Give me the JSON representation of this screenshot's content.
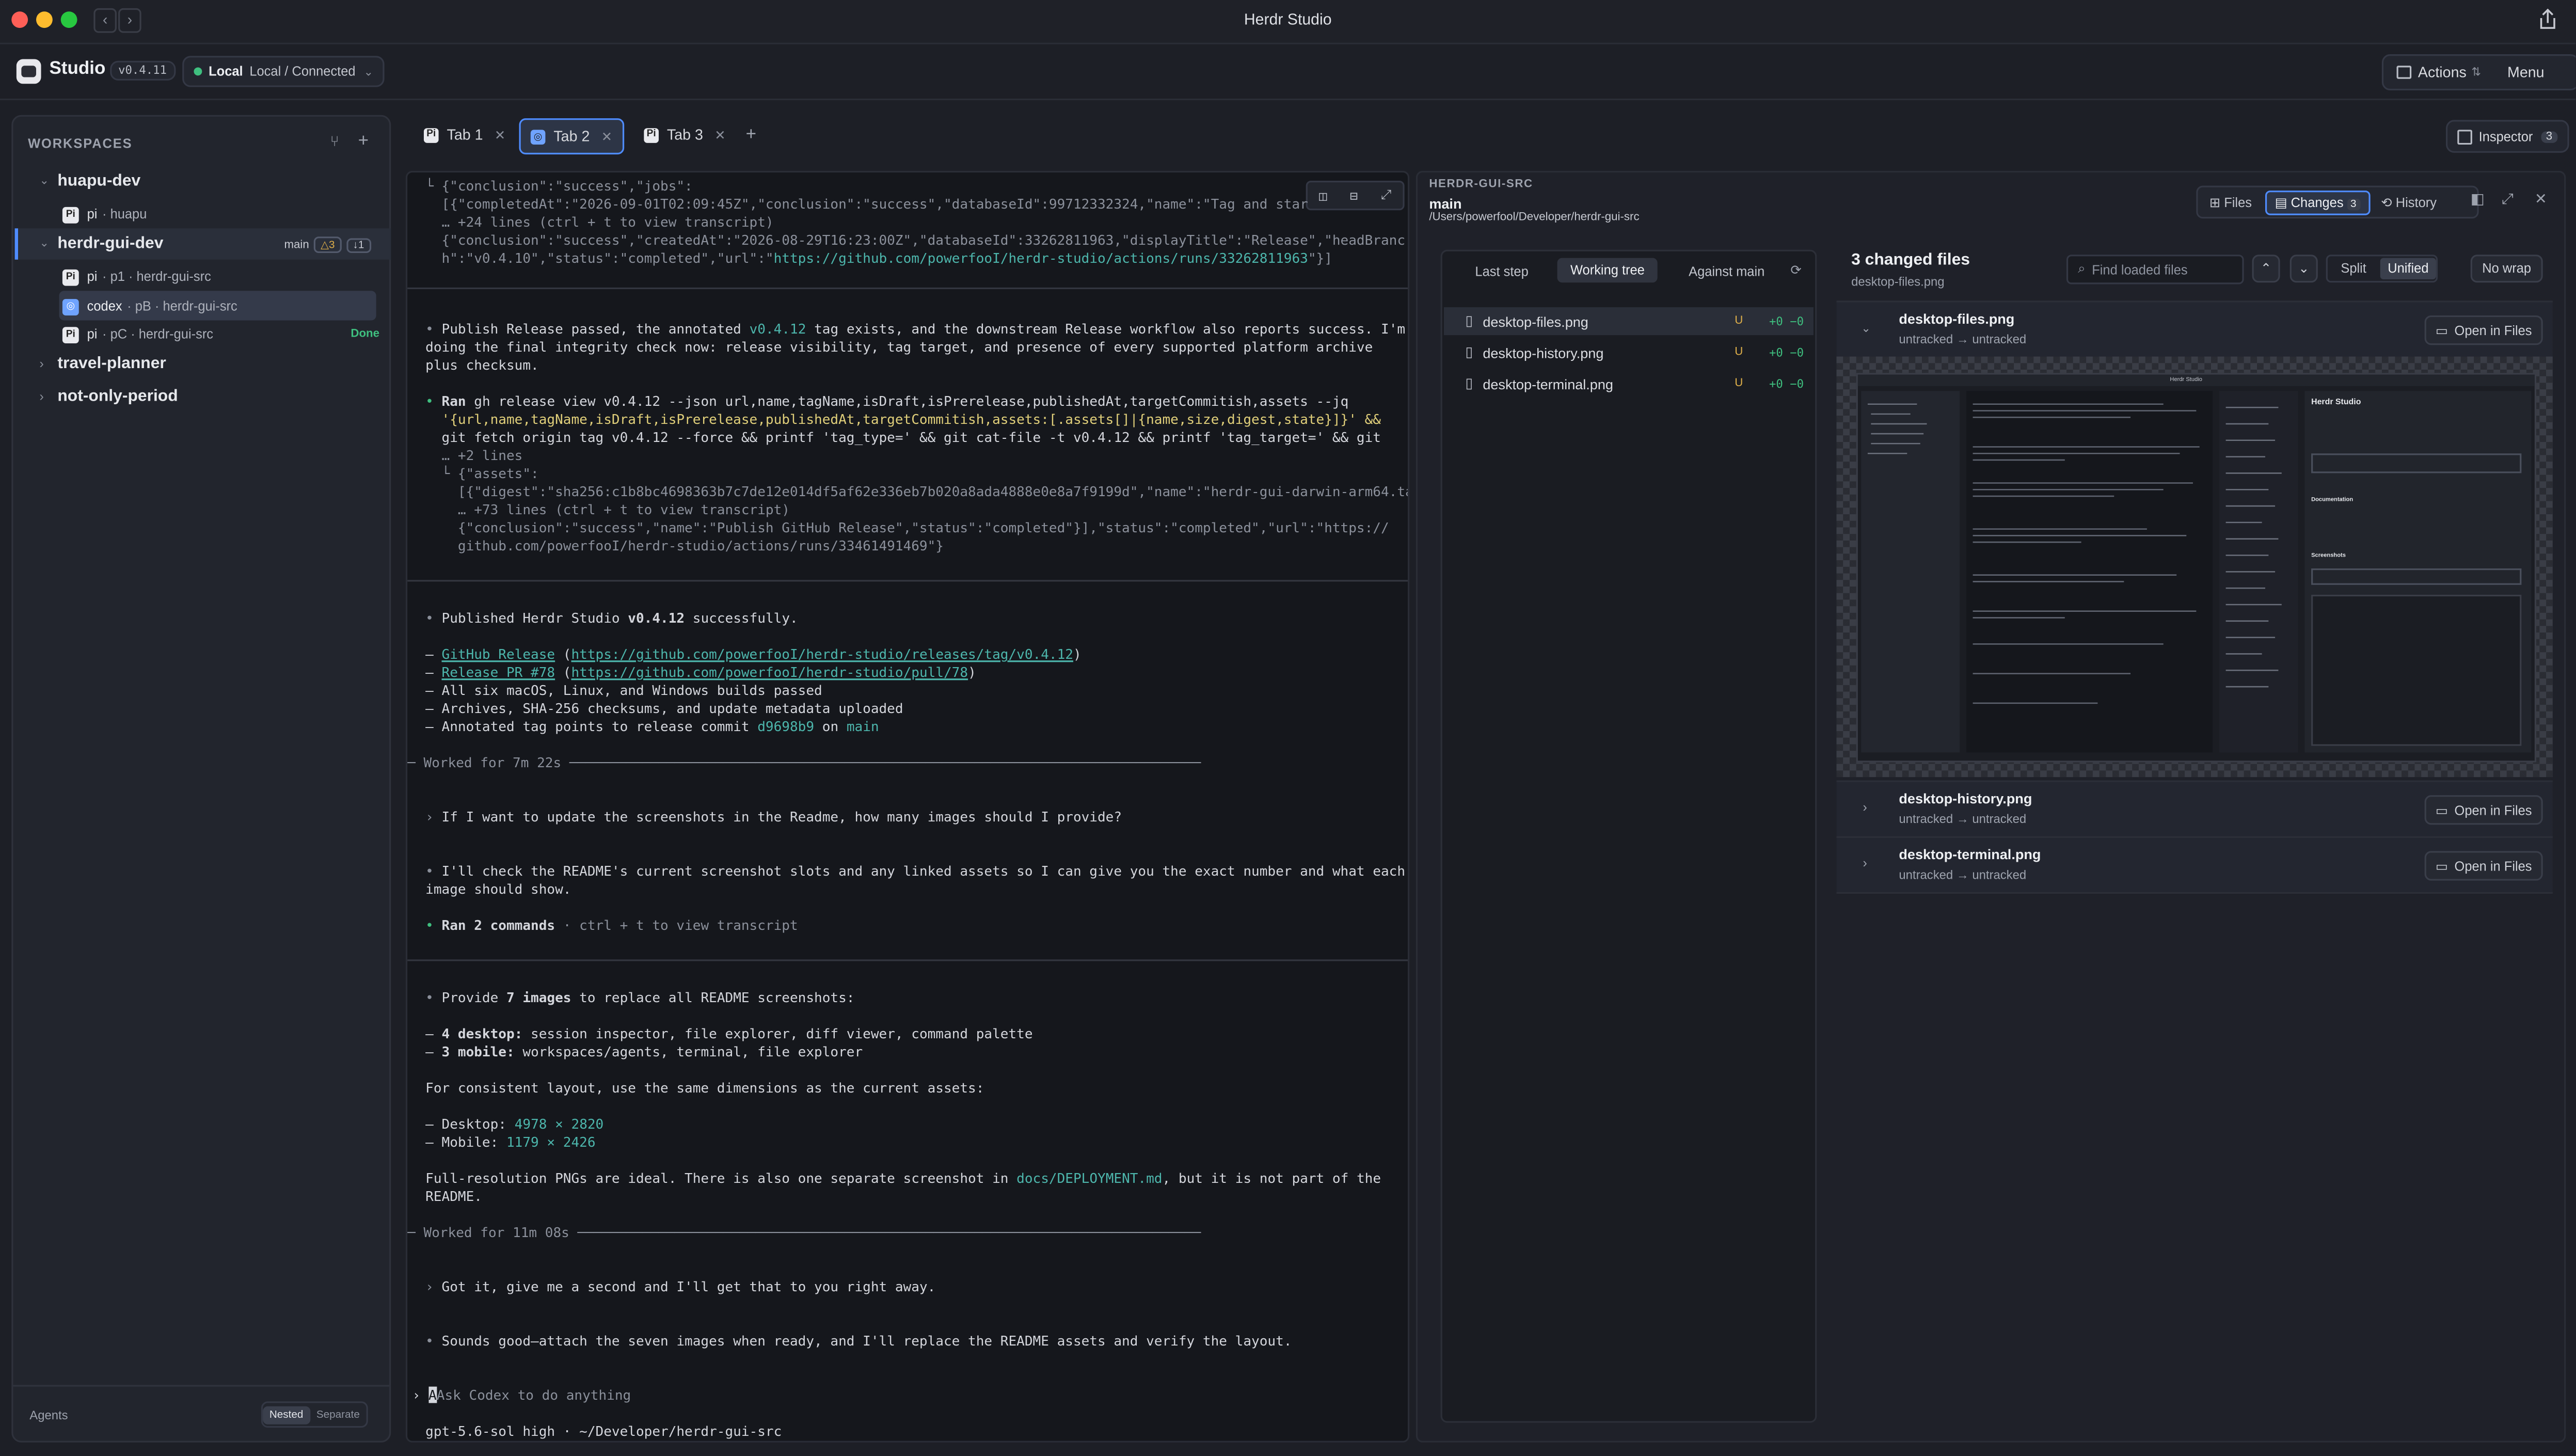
{
  "window": {
    "title": "Herdr Studio"
  },
  "header": {
    "app_name": "Studio",
    "version": "v0.4.11",
    "connection_label": "Local",
    "connection_status": "Local / Connected",
    "actions_label": "Actions",
    "menu_label": "Menu"
  },
  "sidebar": {
    "section_title": "WORKSPACES",
    "workspaces": [
      {
        "name": "huapu-dev",
        "agents": [
          {
            "avatar": "Pi",
            "name": "pi",
            "detail": "· huapu"
          }
        ]
      },
      {
        "name": "herdr-gui-dev",
        "branch": "main",
        "badge_a": "△3",
        "badge_b": "↓1",
        "agents": [
          {
            "avatar": "Pi",
            "name": "pi",
            "detail": "· p1 · herdr-gui-src"
          },
          {
            "avatar": "◎",
            "name": "codex",
            "detail": "· pB · herdr-gui-src"
          },
          {
            "avatar": "Pi",
            "name": "pi",
            "detail": "· pC · herdr-gui-src",
            "status": "Done"
          }
        ]
      },
      {
        "name": "travel-planner"
      },
      {
        "name": "not-only-period"
      }
    ],
    "footer": {
      "label": "Agents",
      "nested": "Nested",
      "separate": "Separate"
    }
  },
  "tabs": [
    {
      "label": "Tab 1"
    },
    {
      "label": "Tab 2"
    },
    {
      "label": "Tab 3"
    }
  ],
  "inspector_button": {
    "label": "Inspector",
    "count": "3"
  },
  "transcript": {
    "l1": "└ {\"conclusion\":\"success\",\"jobs\":",
    "l2": "  [{\"completedAt\":\"2026-09-01T02:09:45Z\",\"conclusion\":\"success\",\"databaseId\":99712332324,\"name\":\"Tag and star",
    "l3": "  … +24 lines (ctrl + t to view transcript)",
    "l4": "  {\"conclusion\":\"success\",\"createdAt\":\"2026-08-29T16:23:00Z\",\"databaseId\":33262811963,\"displayTitle\":\"Release\",\"headBranc",
    "l5a": "  h\":\"v0.4.10\",\"status\":\"completed\",\"url\":\"",
    "l5b": "https://github.com/powerfooI/herdr-studio/actions/runs/33262811963",
    "l5c": "\"}]",
    "p1a": "Publish Release passed, the annotated ",
    "p1tag": "v0.4.12",
    "p1b": " tag exists, and the downstream Release workflow also reports success. I'm",
    "p1l2": "doing the final integrity check now: release visibility, tag target, and presence of every supported platform archive",
    "p1l3": "plus checksum.",
    "ran1": "Ran",
    "cmd1": " gh release view v0.4.12 --json url,name,tagName,isDraft,isPrerelease,publishedAt,targetCommitish,assets --jq",
    "cmd2": "  '{url,name,tagName,isDraft,isPrerelease,publishedAt,targetCommitish,assets:[.assets[]|{name,size,digest,state}]}' &&",
    "cmd3": "  git fetch origin tag v0.4.12 --force && printf 'tag_type=' && git cat-file -t v0.4.12 && printf 'tag_target=' && git",
    "cmd4": "  … +2 lines",
    "out1": "  └ {\"assets\":",
    "out2": "    [{\"digest\":\"sha256:c1b8bc4698363b7c7de12e014df5af62e336eb7b020a8ada4888e0e8a7f9199d\",\"name\":\"herdr-gui-darwin-arm64.tar",
    "out3": "    … +73 lines (ctrl + t to view transcript)",
    "out4": "    {\"conclusion\":\"success\",\"name\":\"Publish GitHub Release\",\"status\":\"completed\"}],\"status\":\"completed\",\"url\":\"https://",
    "out5": "    github.com/powerfooI/herdr-studio/actions/runs/33461491469\"}",
    "pub1a": "Published Herdr Studio ",
    "pub1b": "v0.4.12",
    "pub1c": " successfully.",
    "gh_link": "GitHub Release",
    "gh_url": "https://github.com/powerfooI/herdr-studio/releases/tag/v0.4.12",
    "pr_link": "Release PR #78",
    "pr_url": "https://github.com/powerfooI/herdr-studio/pull/78",
    "b3": "All six macOS, Linux, and Windows builds passed",
    "b4": "Archives, SHA-256 checksums, and update metadata uploaded",
    "b5a": "Annotated tag points to release commit ",
    "b5commit": "d9698b9",
    "b5on": " on ",
    "b5main": "main",
    "worked1": "Worked for 7m 22s",
    "user1": "If I want to update the screenshots in the Readme, how many images should I provide?",
    "a2l1": "I'll check the README's current screenshot slots and any linked assets so I can give you the exact number and what each",
    "a2l2": "image should show.",
    "ran2": "Ran 2 commands",
    "ran2b": " · ctrl + t to view transcript",
    "p3a": "Provide ",
    "p3b": "7 images",
    "p3c": " to replace all README screenshots:",
    "d1a": "4 desktop:",
    "d1b": " session inspector, file explorer, diff viewer, command palette",
    "d2a": "3 mobile:",
    "d2b": " workspaces/agents, terminal, file explorer",
    "cons": "For consistent layout, use the same dimensions as the current assets:",
    "desk_label": "Desktop: ",
    "desk_dim": "4978 × 2820",
    "mob_label": "Mobile: ",
    "mob_dim": "1179 × 2426",
    "full1": "Full-resolution PNGs are ideal. There is also one separate screenshot in ",
    "full_doc": "docs/DEPLOYMENT.md",
    "full2": ", but it is not part of the",
    "full3": "README.",
    "worked2": "Worked for 11m 08s",
    "user2": "Got it, give me a second and I'll get that to you right away.",
    "a4": "Sounds good—attach the seven images when ready, and I'll replace the README assets and verify the layout.",
    "prompt_placeholder": "Ask Codex to do anything",
    "status_line": "gpt-5.6-sol high · ~/Developer/herdr-gui-src"
  },
  "inspector": {
    "repo": "HERDR-GUI-SRC",
    "branch": "main",
    "path": "/Users/powerfool/Developer/herdr-gui-src",
    "tabs": {
      "files": "Files",
      "changes": "Changes",
      "changes_count": "3",
      "history": "History"
    },
    "scope": {
      "last_step": "Last step",
      "working_tree": "Working tree",
      "against_main": "Against main"
    },
    "files": [
      {
        "name": "desktop-files.png",
        "status": "U",
        "diff": "+0 −0"
      },
      {
        "name": "desktop-history.png",
        "status": "U",
        "diff": "+0 −0"
      },
      {
        "name": "desktop-terminal.png",
        "status": "U",
        "diff": "+0 −0"
      }
    ],
    "changed_title": "3 changed files",
    "changed_sub": "desktop-files.png",
    "find_placeholder": "Find loaded files",
    "split": "Split",
    "unified": "Unified",
    "nowrap": "No wrap",
    "diffs": [
      {
        "name": "desktop-files.png",
        "status": "untracked → untracked",
        "open": "Open in Files"
      },
      {
        "name": "desktop-history.png",
        "status": "untracked → untracked",
        "open": "Open in Files"
      },
      {
        "name": "desktop-terminal.png",
        "status": "untracked → untracked",
        "open": "Open in Files"
      }
    ]
  },
  "preview": {
    "title": "Herdr Studio",
    "doc_heading": "Documentation",
    "shots_heading": "Screenshots"
  },
  "colors": {
    "accent": "#4f8cff",
    "teal": "#4db6ac",
    "done": "#3fbf7f",
    "bg": "#1d1f26"
  }
}
